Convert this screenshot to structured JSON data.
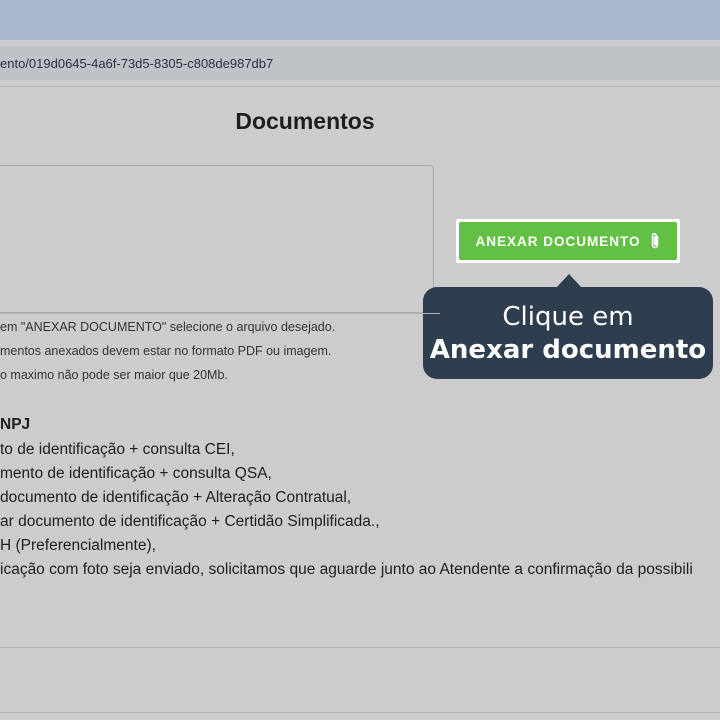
{
  "browser": {
    "url": "ento/019d0645-4a6f-73d5-8305-c808de987db7"
  },
  "page": {
    "title": "Documentos"
  },
  "upload": {
    "attach_button_label": "ANEXAR DOCUMENTO",
    "attach_icon": "paperclip-icon",
    "button_color": "#62c144"
  },
  "tooltip": {
    "line1": "Clique em",
    "line2": "Anexar documento",
    "background": "#2e3e4e"
  },
  "notes": [
    "em \"ANEXAR DOCUMENTO\" selecione o arquivo desejado.",
    "mentos anexados devem estar no formato PDF ou imagem.",
    "o maximo não pode ser maior que 20Mb."
  ],
  "requirements": {
    "title": "NPJ",
    "items": [
      "to de identificação + consulta CEI,",
      "mento de identificação + consulta QSA,",
      "documento de identificação + Alteração Contratual,",
      "ar documento de identificação + Certidão Simplificada.,",
      "H (Preferencialmente),",
      "icação com foto seja enviado, solicitamos que aguarde junto ao Atendente a confirmação da possibili"
    ]
  }
}
